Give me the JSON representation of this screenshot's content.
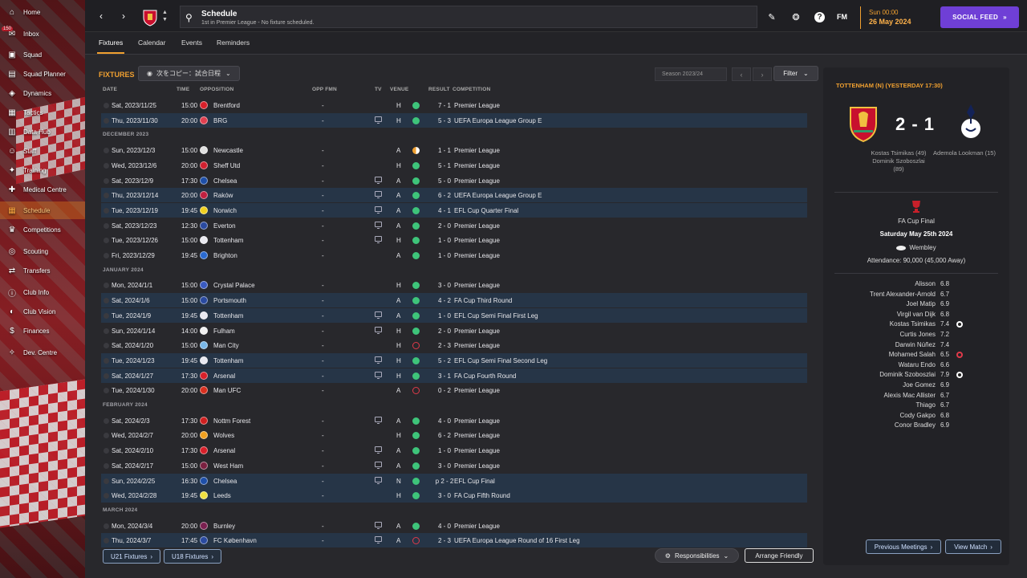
{
  "sidebar": {
    "inbox_badge": "150",
    "items": [
      {
        "label": "Home",
        "icon": "home-icon"
      },
      {
        "label": "Inbox",
        "icon": "inbox-icon"
      },
      {
        "label": "Squad",
        "icon": "shirt-icon"
      },
      {
        "label": "Squad Planner",
        "icon": "planner-icon"
      },
      {
        "label": "Dynamics",
        "icon": "dynamics-icon"
      },
      {
        "label": "Tactics",
        "icon": "tactics-icon"
      },
      {
        "label": "Data Hub",
        "icon": "chart-icon"
      },
      {
        "label": "Staff",
        "icon": "staff-icon"
      },
      {
        "label": "Training",
        "icon": "training-icon"
      },
      {
        "label": "Medical Centre",
        "icon": "medical-icon"
      },
      {
        "label": "Schedule",
        "icon": "calendar-icon"
      },
      {
        "label": "Competitions",
        "icon": "trophy-icon"
      },
      {
        "label": "Scouting",
        "icon": "scout-icon"
      },
      {
        "label": "Transfers",
        "icon": "transfer-icon"
      },
      {
        "label": "Club Info",
        "icon": "info-icon"
      },
      {
        "label": "Club Vision",
        "icon": "vision-icon"
      },
      {
        "label": "Finances",
        "icon": "finance-icon"
      },
      {
        "label": "Dev. Centre",
        "icon": "dev-icon"
      }
    ]
  },
  "header": {
    "title": "Schedule",
    "subtitle": "1st in Premier League - No fixture scheduled.",
    "date_time": "Sun 00:00",
    "date": "26 May 2024",
    "social_feed": "SOCIAL FEED",
    "fm_logo": "FM",
    "help": "?"
  },
  "tabs": [
    "Fixtures",
    "Calendar",
    "Events",
    "Reminders"
  ],
  "fixtures": {
    "title": "FIXTURES",
    "copy_label": "次をコピー：試合日程",
    "season": "Season 2023/24",
    "filter": "Filter",
    "columns": {
      "date": "DATE",
      "time": "TIME",
      "opposition": "OPPOSITION",
      "opp_fmn": "OPP FMN",
      "tv": "TV",
      "venue": "VENUE",
      "result": "RESULT",
      "competition": "COMPETITION"
    },
    "rows": [
      {
        "type": "match",
        "date": "Sat, 2023/11/25",
        "time": "15:00",
        "opp": "Brentford",
        "fmn": "-",
        "tv": false,
        "venue": "H",
        "res": "W",
        "score": "7 - 1",
        "comp": "Premier League",
        "eu": false,
        "color": "#d8202a"
      },
      {
        "type": "match",
        "date": "Thu, 2023/11/30",
        "time": "20:00",
        "opp": "BRG",
        "fmn": "-",
        "tv": true,
        "venue": "H",
        "res": "W",
        "score": "5 - 3",
        "comp": "UEFA Europa League Group E",
        "eu": true,
        "color": "#e04050"
      },
      {
        "type": "month",
        "label": "DECEMBER 2023"
      },
      {
        "type": "match",
        "date": "Sun, 2023/12/3",
        "time": "15:00",
        "opp": "Newcastle",
        "fmn": "-",
        "tv": false,
        "venue": "A",
        "res": "D",
        "score": "1 - 1",
        "comp": "Premier League",
        "eu": false,
        "color": "#e0e0e0"
      },
      {
        "type": "match",
        "date": "Wed, 2023/12/6",
        "time": "20:00",
        "opp": "Sheff Utd",
        "fmn": "-",
        "tv": false,
        "venue": "H",
        "res": "W",
        "score": "5 - 1",
        "comp": "Premier League",
        "eu": false,
        "color": "#d02030"
      },
      {
        "type": "match",
        "date": "Sat, 2023/12/9",
        "time": "17:30",
        "opp": "Chelsea",
        "fmn": "-",
        "tv": true,
        "venue": "A",
        "res": "W",
        "score": "5 - 0",
        "comp": "Premier League",
        "eu": false,
        "color": "#1e4fa8"
      },
      {
        "type": "match",
        "date": "Thu, 2023/12/14",
        "time": "20:00",
        "opp": "Raków",
        "fmn": "-",
        "tv": true,
        "venue": "A",
        "res": "W",
        "score": "6 - 2",
        "comp": "UEFA Europa League Group E",
        "eu": true,
        "color": "#c02040"
      },
      {
        "type": "match",
        "date": "Tue, 2023/12/19",
        "time": "19:45",
        "opp": "Norwich",
        "fmn": "-",
        "tv": true,
        "venue": "A",
        "res": "W",
        "score": "4 - 1",
        "comp": "EFL Cup Quarter Final",
        "eu": true,
        "color": "#f0d020"
      },
      {
        "type": "match",
        "date": "Sat, 2023/12/23",
        "time": "12:30",
        "opp": "Everton",
        "fmn": "-",
        "tv": true,
        "venue": "A",
        "res": "W",
        "score": "2 - 0",
        "comp": "Premier League",
        "eu": false,
        "color": "#2a4aa0"
      },
      {
        "type": "match",
        "date": "Tue, 2023/12/26",
        "time": "15:00",
        "opp": "Tottenham",
        "fmn": "-",
        "tv": true,
        "venue": "H",
        "res": "W",
        "score": "1 - 0",
        "comp": "Premier League",
        "eu": false,
        "color": "#e8e8f0"
      },
      {
        "type": "match",
        "date": "Fri, 2023/12/29",
        "time": "19:45",
        "opp": "Brighton",
        "fmn": "-",
        "tv": false,
        "venue": "A",
        "res": "W",
        "score": "1 - 0",
        "comp": "Premier League",
        "eu": false,
        "color": "#2a6ad0"
      },
      {
        "type": "month",
        "label": "JANUARY 2024"
      },
      {
        "type": "match",
        "date": "Mon, 2024/1/1",
        "time": "15:00",
        "opp": "Crystal Palace",
        "fmn": "-",
        "tv": false,
        "venue": "H",
        "res": "W",
        "score": "3 - 0",
        "comp": "Premier League",
        "eu": false,
        "color": "#3a5ac0"
      },
      {
        "type": "match",
        "date": "Sat, 2024/1/6",
        "time": "15:00",
        "opp": "Portsmouth",
        "fmn": "-",
        "tv": false,
        "venue": "A",
        "res": "W",
        "score": "4 - 2",
        "comp": "FA Cup Third Round",
        "eu": true,
        "color": "#2a4aa0"
      },
      {
        "type": "match",
        "date": "Tue, 2024/1/9",
        "time": "19:45",
        "opp": "Tottenham",
        "fmn": "-",
        "tv": true,
        "venue": "A",
        "res": "W",
        "score": "1 - 0",
        "comp": "EFL Cup Semi Final First Leg",
        "eu": true,
        "color": "#e8e8f0"
      },
      {
        "type": "match",
        "date": "Sun, 2024/1/14",
        "time": "14:00",
        "opp": "Fulham",
        "fmn": "-",
        "tv": true,
        "venue": "H",
        "res": "W",
        "score": "2 - 0",
        "comp": "Premier League",
        "eu": false,
        "color": "#f0f0f0"
      },
      {
        "type": "match",
        "date": "Sat, 2024/1/20",
        "time": "15:00",
        "opp": "Man City",
        "fmn": "-",
        "tv": false,
        "venue": "H",
        "res": "L",
        "score": "2 - 3",
        "comp": "Premier League",
        "eu": false,
        "color": "#7ab8e8"
      },
      {
        "type": "match",
        "date": "Tue, 2024/1/23",
        "time": "19:45",
        "opp": "Tottenham",
        "fmn": "-",
        "tv": true,
        "venue": "H",
        "res": "W",
        "score": "5 - 2",
        "comp": "EFL Cup Semi Final Second Leg",
        "eu": true,
        "color": "#e8e8f0"
      },
      {
        "type": "match",
        "date": "Sat, 2024/1/27",
        "time": "17:30",
        "opp": "Arsenal",
        "fmn": "-",
        "tv": true,
        "venue": "H",
        "res": "W",
        "score": "3 - 1",
        "comp": "FA Cup Fourth Round",
        "eu": true,
        "color": "#d8202a"
      },
      {
        "type": "match",
        "date": "Tue, 2024/1/30",
        "time": "20:00",
        "opp": "Man UFC",
        "fmn": "-",
        "tv": false,
        "venue": "A",
        "res": "L",
        "score": "0 - 2",
        "comp": "Premier League",
        "eu": false,
        "color": "#d83020"
      },
      {
        "type": "month",
        "label": "FEBRUARY 2024"
      },
      {
        "type": "match",
        "date": "Sat, 2024/2/3",
        "time": "17:30",
        "opp": "Nottm Forest",
        "fmn": "-",
        "tv": true,
        "venue": "A",
        "res": "W",
        "score": "4 - 0",
        "comp": "Premier League",
        "eu": false,
        "color": "#d02020"
      },
      {
        "type": "match",
        "date": "Wed, 2024/2/7",
        "time": "20:00",
        "opp": "Wolves",
        "fmn": "-",
        "tv": false,
        "venue": "H",
        "res": "W",
        "score": "6 - 2",
        "comp": "Premier League",
        "eu": false,
        "color": "#f0a020"
      },
      {
        "type": "match",
        "date": "Sat, 2024/2/10",
        "time": "17:30",
        "opp": "Arsenal",
        "fmn": "-",
        "tv": true,
        "venue": "A",
        "res": "W",
        "score": "1 - 0",
        "comp": "Premier League",
        "eu": false,
        "color": "#d8202a"
      },
      {
        "type": "match",
        "date": "Sat, 2024/2/17",
        "time": "15:00",
        "opp": "West Ham",
        "fmn": "-",
        "tv": true,
        "venue": "A",
        "res": "W",
        "score": "3 - 0",
        "comp": "Premier League",
        "eu": false,
        "color": "#7a2040"
      },
      {
        "type": "match",
        "date": "Sun, 2024/2/25",
        "time": "16:30",
        "opp": "Chelsea",
        "fmn": "-",
        "tv": true,
        "venue": "N",
        "res": "W",
        "score": "p 2 - 2",
        "comp": "EFL Cup Final",
        "eu": true,
        "color": "#1e4fa8"
      },
      {
        "type": "match",
        "date": "Wed, 2024/2/28",
        "time": "19:45",
        "opp": "Leeds",
        "fmn": "-",
        "tv": false,
        "venue": "H",
        "res": "W",
        "score": "3 - 0",
        "comp": "FA Cup Fifth Round",
        "eu": true,
        "color": "#f0e040"
      },
      {
        "type": "month",
        "label": "MARCH 2024"
      },
      {
        "type": "match",
        "date": "Mon, 2024/3/4",
        "time": "20:00",
        "opp": "Burnley",
        "fmn": "-",
        "tv": true,
        "venue": "A",
        "res": "W",
        "score": "4 - 0",
        "comp": "Premier League",
        "eu": false,
        "color": "#7a2050"
      },
      {
        "type": "match",
        "date": "Thu, 2024/3/7",
        "time": "17:45",
        "opp": "FC København",
        "fmn": "-",
        "tv": true,
        "venue": "A",
        "res": "L",
        "score": "2 - 3",
        "comp": "UEFA Europa League Round of 16 First Leg",
        "eu": true,
        "color": "#2a4aa0"
      }
    ],
    "u21": "U21 Fixtures",
    "u18": "U18 Fixtures",
    "responsibilities": "Responsibilities",
    "arrange": "Arrange Friendly"
  },
  "result_colors": {
    "W": "#3ec47a",
    "D": "#f0a030",
    "L": "#e03a4a"
  },
  "last_match": {
    "title": "TOTTENHAM (N) (YESTERDAY 17:30)",
    "score": "2 - 1",
    "home_scorers": [
      "Kostas Tsimikas (49)",
      "Dominik Szoboszlai",
      "(89)"
    ],
    "away_scorers": [
      "Ademola Lookman (15)"
    ],
    "competition": "FA Cup Final",
    "date": "Saturday May 25th 2024",
    "stadium": "Wembley",
    "attendance": "Attendance: 90,000 (45,000 Away)",
    "players": [
      {
        "name": "Alisson",
        "rating": "6.8",
        "icon": ""
      },
      {
        "name": "Trent Alexander-Arnold",
        "rating": "6.7",
        "icon": ""
      },
      {
        "name": "Joel Matip",
        "rating": "6.9",
        "icon": ""
      },
      {
        "name": "Virgil van Dijk",
        "rating": "6.8",
        "icon": ""
      },
      {
        "name": "Kostas Tsimikas",
        "rating": "7.4",
        "icon": "ball"
      },
      {
        "name": "Curtis Jones",
        "rating": "7.2",
        "icon": ""
      },
      {
        "name": "Darwin Núñez",
        "rating": "7.4",
        "icon": ""
      },
      {
        "name": "Mohamed Salah",
        "rating": "6.5",
        "icon": "red"
      },
      {
        "name": "Wataru Endo",
        "rating": "6.6",
        "icon": ""
      },
      {
        "name": "Dominik Szoboszlai",
        "rating": "7.9",
        "icon": "ball"
      },
      {
        "name": "Joe Gomez",
        "rating": "6.9",
        "icon": ""
      },
      {
        "name": "Alexis Mac Allister",
        "rating": "6.7",
        "icon": ""
      },
      {
        "name": "Thiago",
        "rating": "6.7",
        "icon": ""
      },
      {
        "name": "Cody Gakpo",
        "rating": "6.8",
        "icon": ""
      },
      {
        "name": "Conor Bradley",
        "rating": "6.9",
        "icon": ""
      }
    ],
    "previous_meetings": "Previous Meetings",
    "view_match": "View Match"
  }
}
